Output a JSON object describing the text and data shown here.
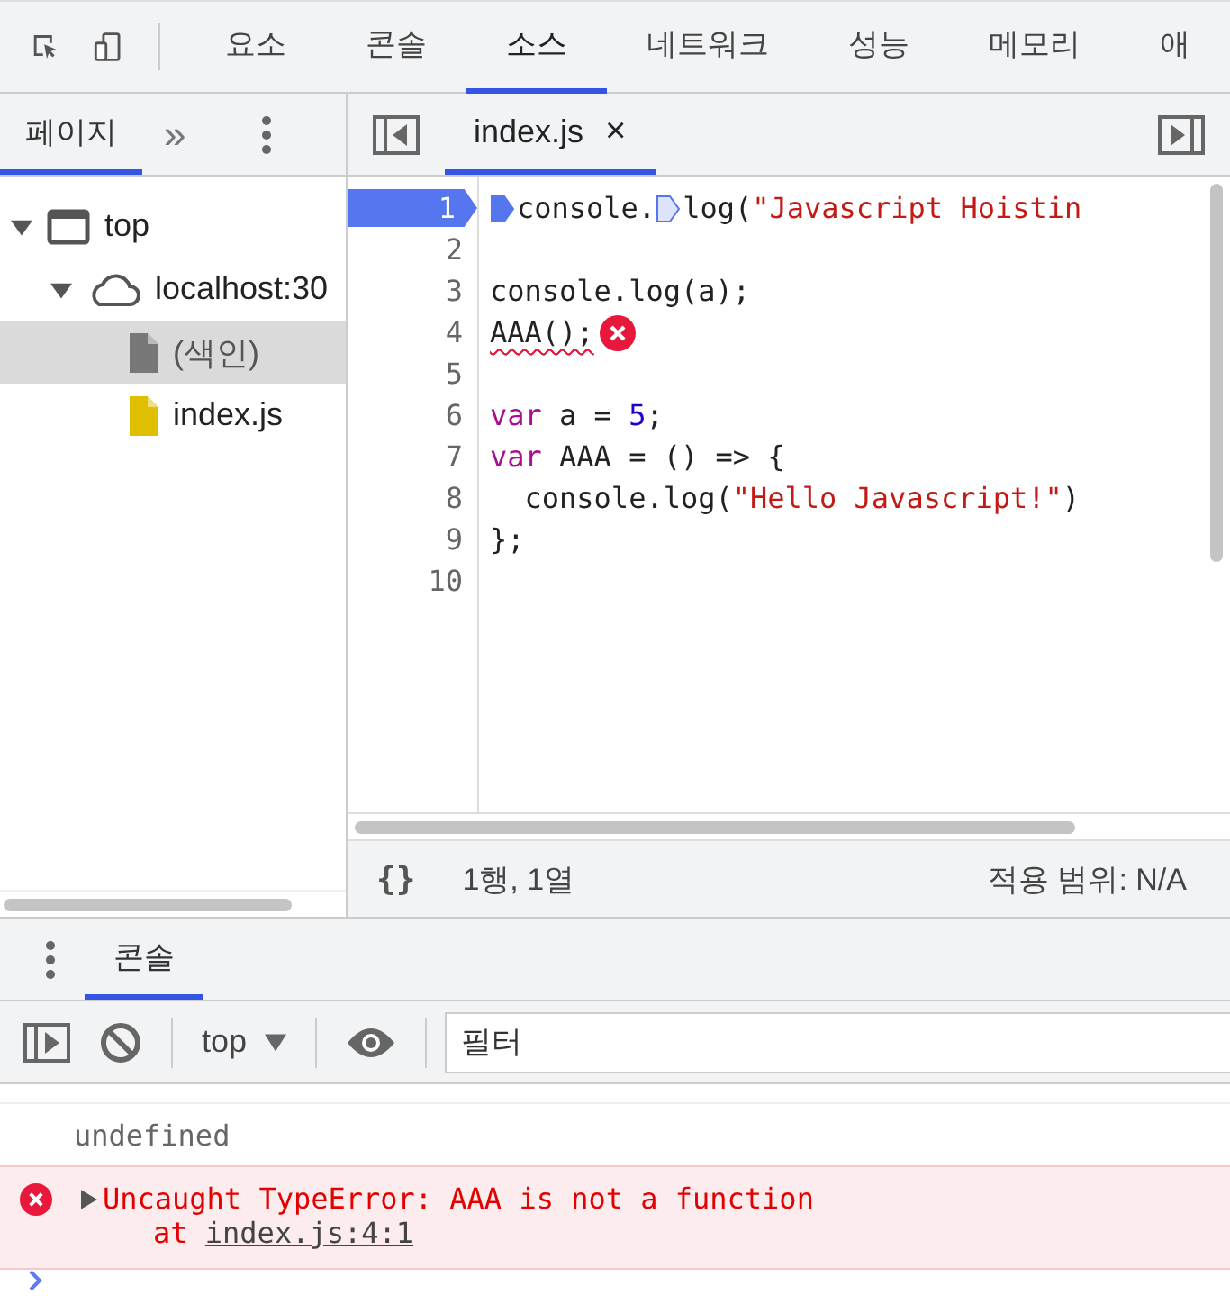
{
  "main_tabs": [
    {
      "label": "요소",
      "selected": false
    },
    {
      "label": "콘솔",
      "selected": false
    },
    {
      "label": "소스",
      "selected": true
    },
    {
      "label": "네트워크",
      "selected": false
    },
    {
      "label": "성능",
      "selected": false
    },
    {
      "label": "메모리",
      "selected": false
    },
    {
      "label": "애",
      "selected": false
    }
  ],
  "navigator": {
    "tabs": [
      {
        "label": "페이지",
        "selected": true
      }
    ],
    "more": "»",
    "tree": [
      {
        "label": "top",
        "kind": "frame",
        "expanded": true,
        "selected": false,
        "children": [
          {
            "label": "localhost:30",
            "kind": "cloud",
            "expanded": true,
            "selected": false,
            "children": [
              {
                "label": "(색인)",
                "kind": "document",
                "selected": true
              },
              {
                "label": "index.js",
                "kind": "script",
                "selected": false
              }
            ]
          }
        ]
      }
    ]
  },
  "editor": {
    "tabs": [
      {
        "label": "index.js",
        "selected": true,
        "close": "×"
      }
    ],
    "lines": [
      {
        "number": "1",
        "current": true,
        "error": false,
        "tokens": [
          {
            "kind": "breakpoint"
          },
          {
            "kind": "plain",
            "text": "console."
          },
          {
            "kind": "breakpoint"
          },
          {
            "kind": "plain",
            "text": "log("
          },
          {
            "kind": "string",
            "text": "\"Javascript Hoistin"
          }
        ]
      },
      {
        "number": "2",
        "current": false,
        "error": false
      },
      {
        "number": "3",
        "current": false,
        "error": false,
        "tokens": [
          {
            "kind": "plain",
            "text": "console.log(a);"
          }
        ]
      },
      {
        "number": "4",
        "current": false,
        "error": true,
        "tokens": [
          {
            "kind": "plain",
            "text": "AAA();"
          }
        ]
      },
      {
        "number": "5",
        "current": false,
        "error": false
      },
      {
        "number": "6",
        "current": false,
        "error": false,
        "tokens": [
          {
            "kind": "keyword",
            "text": "var"
          },
          {
            "kind": "plain",
            "text": " a = "
          },
          {
            "kind": "number",
            "text": "5"
          },
          {
            "kind": "plain",
            "text": ";"
          }
        ]
      },
      {
        "number": "7",
        "current": false,
        "error": false,
        "tokens": [
          {
            "kind": "keyword",
            "text": "var"
          },
          {
            "kind": "plain",
            "text": " AAA = () => {"
          }
        ]
      },
      {
        "number": "8",
        "current": false,
        "error": false,
        "tokens": [
          {
            "kind": "plain",
            "text": "  console.log("
          },
          {
            "kind": "string",
            "text": "\"Hello Javascript!\""
          },
          {
            "kind": "plain",
            "text": ")"
          }
        ]
      },
      {
        "number": "9",
        "current": false,
        "error": false,
        "tokens": [
          {
            "kind": "plain",
            "text": "};"
          }
        ]
      },
      {
        "number": "10",
        "current": false,
        "error": false
      }
    ],
    "status": {
      "pretty_print": "{}",
      "position": "1행, 1열",
      "coverage": "적용 범위: N/A"
    }
  },
  "drawer": {
    "tabs": [
      {
        "label": "콘솔",
        "selected": true
      }
    ],
    "context": "top",
    "filter": {
      "placeholder": "필터"
    },
    "messages": [
      {
        "kind": "log",
        "text": "undefined"
      },
      {
        "kind": "error",
        "text": "Uncaught TypeError: AAA is not a function",
        "stack_prefix": "at",
        "link": "index.js:4:1"
      }
    ]
  }
}
